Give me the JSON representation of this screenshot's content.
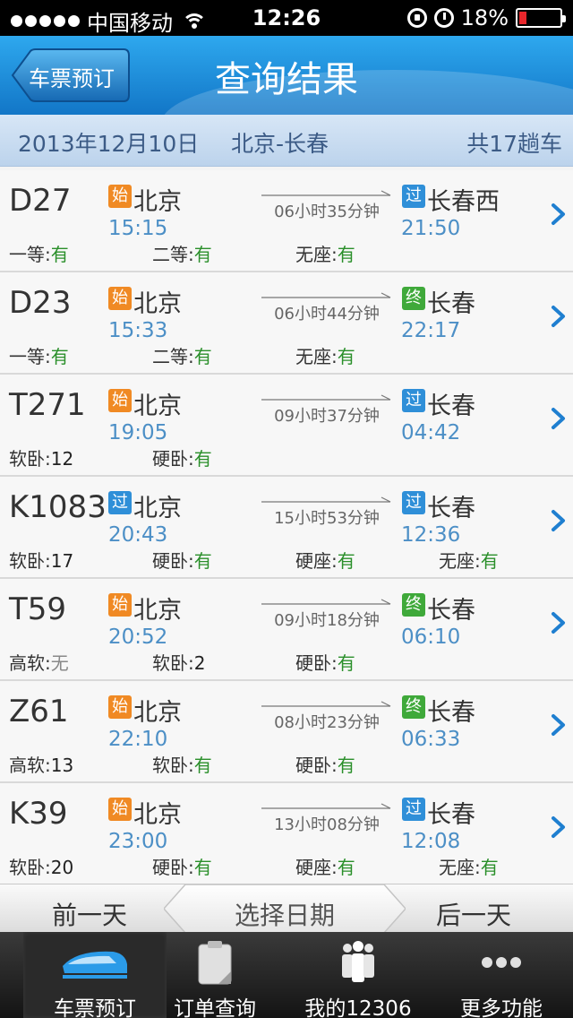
{
  "status_bar": {
    "carrier": "中国移动",
    "time": "12:26",
    "battery": "18%",
    "battery_level": 0.18
  },
  "nav": {
    "back_label": "车票预订",
    "title": "查询结果"
  },
  "summary": {
    "date": "2013年12月10日",
    "route": "北京-长春",
    "count": "共17趟车"
  },
  "trains": [
    {
      "no": "D27",
      "from_tag": "始",
      "from_type": "start",
      "from": "北京",
      "dep": "15:15",
      "duration": "06小时35分钟",
      "to_tag": "过",
      "to_type": "pass",
      "to": "长春西",
      "arr": "21:50",
      "seats": [
        {
          "label": "一等:",
          "value": "有"
        },
        {
          "label": "二等:",
          "value": "有"
        },
        {
          "label": "无座:",
          "value": "有"
        }
      ]
    },
    {
      "no": "D23",
      "from_tag": "始",
      "from_type": "start",
      "from": "北京",
      "dep": "15:33",
      "duration": "06小时44分钟",
      "to_tag": "终",
      "to_type": "end",
      "to": "长春",
      "arr": "22:17",
      "seats": [
        {
          "label": "一等:",
          "value": "有"
        },
        {
          "label": "二等:",
          "value": "有"
        },
        {
          "label": "无座:",
          "value": "有"
        }
      ]
    },
    {
      "no": "T271",
      "from_tag": "始",
      "from_type": "start",
      "from": "北京",
      "dep": "19:05",
      "duration": "09小时37分钟",
      "to_tag": "过",
      "to_type": "pass",
      "to": "长春",
      "arr": "04:42",
      "seats": [
        {
          "label": "软卧:",
          "value": "12"
        },
        {
          "label": "硬卧:",
          "value": "有"
        }
      ]
    },
    {
      "no": "K1083",
      "from_tag": "过",
      "from_type": "pass",
      "from": "北京",
      "dep": "20:43",
      "duration": "15小时53分钟",
      "to_tag": "过",
      "to_type": "pass",
      "to": "长春",
      "arr": "12:36",
      "seats": [
        {
          "label": "软卧:",
          "value": "17"
        },
        {
          "label": "硬卧:",
          "value": "有"
        },
        {
          "label": "硬座:",
          "value": "有"
        },
        {
          "label": "无座:",
          "value": "有"
        }
      ]
    },
    {
      "no": "T59",
      "from_tag": "始",
      "from_type": "start",
      "from": "北京",
      "dep": "20:52",
      "duration": "09小时18分钟",
      "to_tag": "终",
      "to_type": "end",
      "to": "长春",
      "arr": "06:10",
      "seats": [
        {
          "label": "高软:",
          "value": "无"
        },
        {
          "label": "软卧:",
          "value": "2"
        },
        {
          "label": "硬卧:",
          "value": "有"
        }
      ]
    },
    {
      "no": "Z61",
      "from_tag": "始",
      "from_type": "start",
      "from": "北京",
      "dep": "22:10",
      "duration": "08小时23分钟",
      "to_tag": "终",
      "to_type": "end",
      "to": "长春",
      "arr": "06:33",
      "seats": [
        {
          "label": "高软:",
          "value": "13"
        },
        {
          "label": "软卧:",
          "value": "有"
        },
        {
          "label": "硬卧:",
          "value": "有"
        }
      ]
    },
    {
      "no": "K39",
      "from_tag": "始",
      "from_type": "start",
      "from": "北京",
      "dep": "23:00",
      "duration": "13小时08分钟",
      "to_tag": "过",
      "to_type": "pass",
      "to": "长春",
      "arr": "12:08",
      "seats": [
        {
          "label": "软卧:",
          "value": "20"
        },
        {
          "label": "硬卧:",
          "value": "有"
        },
        {
          "label": "硬座:",
          "value": "有"
        },
        {
          "label": "无座:",
          "value": "有"
        }
      ]
    }
  ],
  "date_bar": {
    "prev": "前一天",
    "pick": "选择日期",
    "next": "后一天"
  },
  "tabs": [
    {
      "label": "车票预订",
      "icon": "train-icon",
      "active": true
    },
    {
      "label": "订单查询",
      "icon": "clipboard-icon",
      "active": false
    },
    {
      "label": "我的12306",
      "icon": "people-icon",
      "active": false
    },
    {
      "label": "更多功能",
      "icon": "more-dots-icon",
      "active": false
    }
  ],
  "colors": {
    "nav_blue": "#1e8fdc",
    "time_blue": "#4c8fc6",
    "available_green": "#2a8f2a",
    "start_orange": "#f08a24",
    "pass_blue": "#2f8fd8",
    "end_green": "#3fa93a",
    "battery_red": "#e8262b"
  }
}
